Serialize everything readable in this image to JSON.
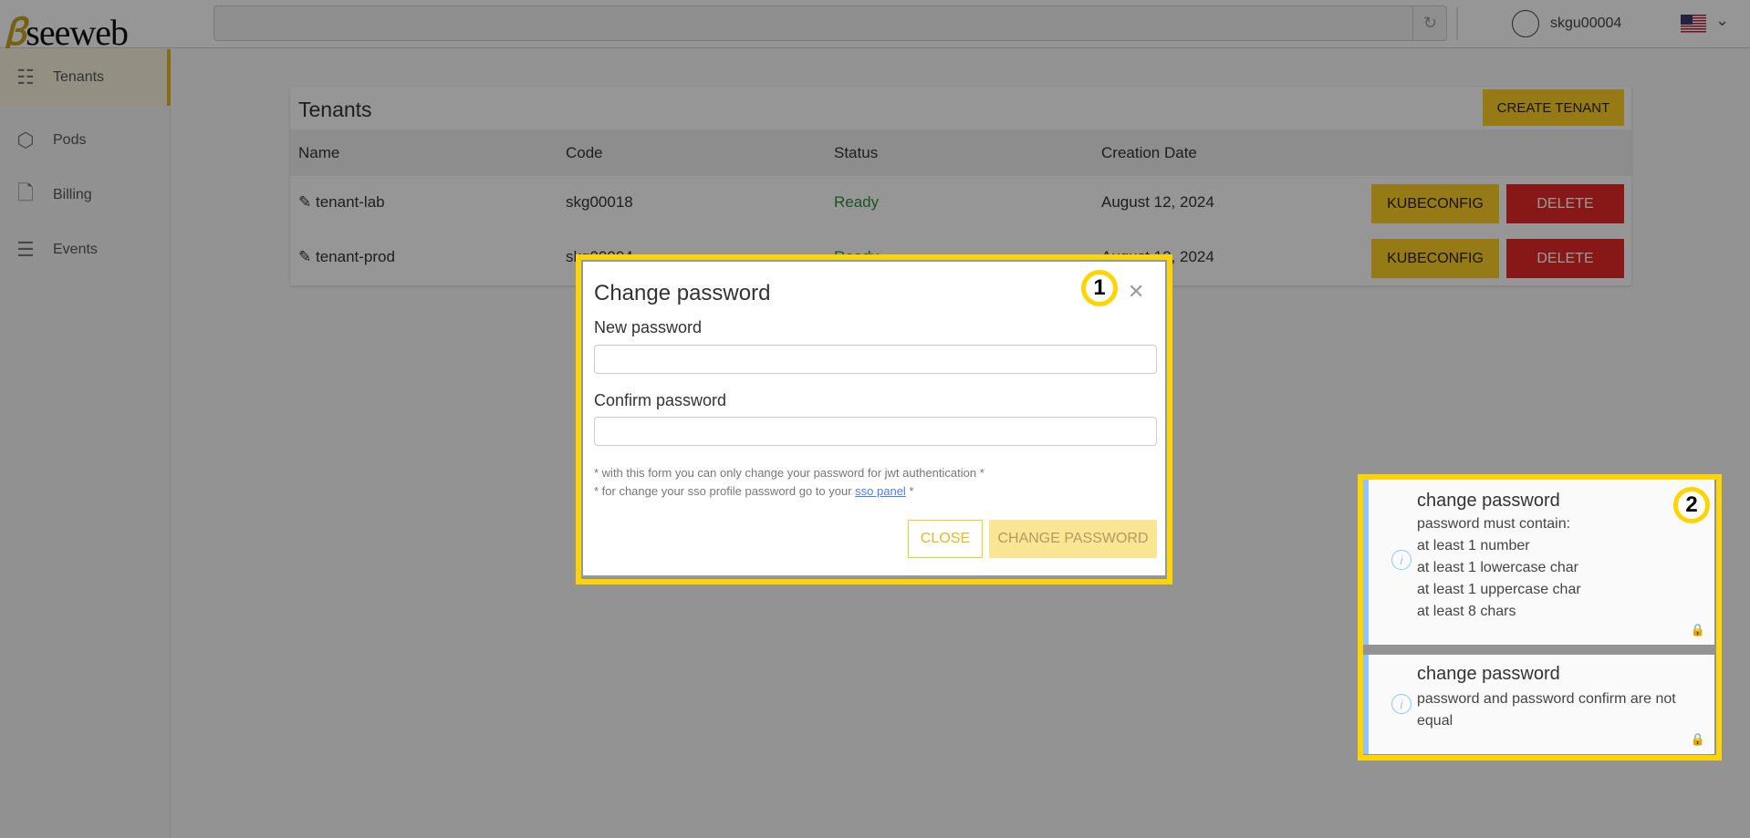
{
  "header": {
    "logo": "seeweb",
    "search_value": "",
    "user": "skgu00004",
    "language": "en-US"
  },
  "sidebar": {
    "items": [
      {
        "label": "Tenants",
        "icon": "server-check-icon",
        "active": true
      },
      {
        "label": "Pods",
        "icon": "cube-icon"
      },
      {
        "label": "Billing",
        "icon": "document-icon"
      },
      {
        "label": "Events",
        "icon": "list-icon"
      }
    ]
  },
  "tenants": {
    "title": "Tenants",
    "create_label": "CREATE TENANT",
    "columns": [
      "Name",
      "Code",
      "Status",
      "Creation Date"
    ],
    "rows": [
      {
        "name": "tenant-lab",
        "code": "skg00018",
        "status": "Ready",
        "date": "August 12, 2024",
        "kube": "KUBECONFIG",
        "delete": "DELETE"
      },
      {
        "name": "tenant-prod",
        "code": "skg00004",
        "status": "Ready",
        "date": "August 12, 2024",
        "kube": "KUBECONFIG",
        "delete": "DELETE"
      }
    ]
  },
  "modal": {
    "title": "Change password",
    "new_label": "New password",
    "confirm_label": "Confirm password",
    "new_value": "",
    "confirm_value": "",
    "note1": "* with this form you can only change your password for jwt authentication *",
    "note2_pre": "* for change your sso profile password go to your ",
    "note2_link": "sso panel",
    "note2_post": " *",
    "close": "CLOSE",
    "submit": "CHANGE PASSWORD"
  },
  "annotations": [
    "1",
    "2"
  ],
  "toasts": [
    {
      "title": "change password",
      "lines": [
        "password must contain:",
        "at least 1 number",
        "at least 1 lowercase char",
        "at least 1 uppercase char",
        "at least 8 chars"
      ]
    },
    {
      "title": "change password",
      "lines": [
        "password and password confirm are not",
        "equal"
      ]
    }
  ],
  "colors": {
    "accent": "#facb23",
    "danger": "#e32828",
    "ready": "#2e8b3e",
    "info": "#90c4fa"
  }
}
